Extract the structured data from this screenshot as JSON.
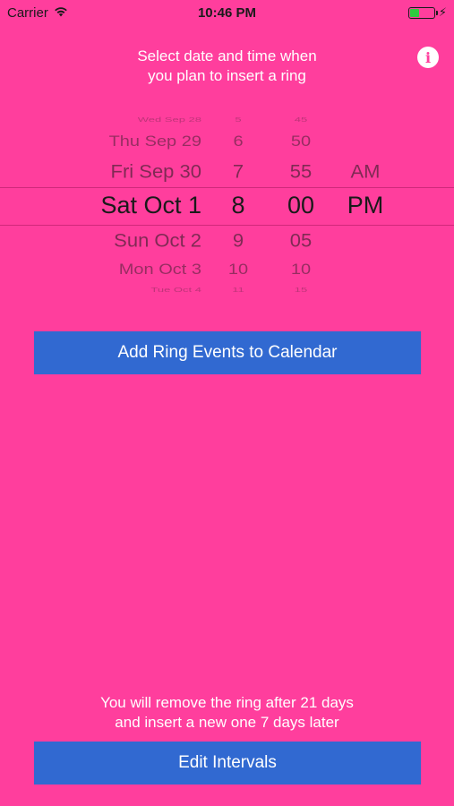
{
  "status_bar": {
    "carrier": "Carrier",
    "time": "10:46 PM",
    "icons": [
      "wifi-icon",
      "battery-icon",
      "charging-bolt-icon"
    ]
  },
  "header": {
    "line1": "Select date and time when",
    "line2": "you plan to insert a ring",
    "info_icon": "info-icon"
  },
  "picker": {
    "dates": [
      "Wed Sep 28",
      "Thu Sep 29",
      "Fri Sep 30",
      "Sat Oct 1",
      "Sun Oct 2",
      "Mon Oct 3",
      "Tue Oct 4"
    ],
    "hours": [
      "5",
      "6",
      "7",
      "8",
      "9",
      "10",
      "11"
    ],
    "minutes": [
      "45",
      "50",
      "55",
      "00",
      "05",
      "10",
      "15"
    ],
    "ampm": [
      "AM",
      "PM"
    ],
    "selected": {
      "date": "Sat Oct 1",
      "hour": "8",
      "minute": "00",
      "ampm": "PM"
    }
  },
  "add_button": {
    "label": "Add Ring Events to Calendar"
  },
  "footer": {
    "line1": "You will remove the ring after 21 days",
    "line2": "and insert a new one 7 days later"
  },
  "edit_button": {
    "label": "Edit Intervals"
  },
  "colors": {
    "background": "#ff3e9d",
    "button": "#3169d1",
    "text": "#ffffff"
  }
}
